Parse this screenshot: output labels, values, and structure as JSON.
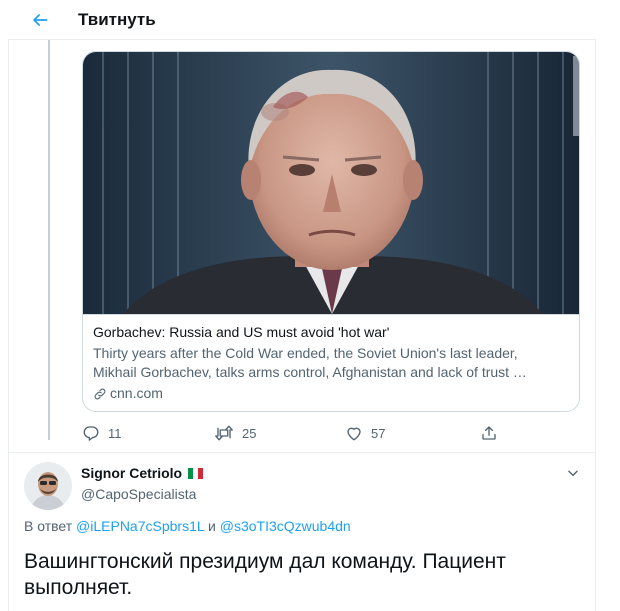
{
  "header": {
    "title": "Твитнуть"
  },
  "card": {
    "title": "Gorbachev: Russia and US must avoid 'hot war'",
    "description_line1": "Thirty years after the Cold War ended, the Soviet Union's last leader,",
    "description_line2": "Mikhail Gorbachev, talks arms control, Afghanistan and lack of trust …",
    "domain": "cnn.com"
  },
  "actions": {
    "replies": "11",
    "retweets": "25",
    "likes": "57"
  },
  "reply": {
    "user_name": "Signor Cetriolo",
    "user_handle": "@CapoSpecialista",
    "reply_prefix": "В ответ",
    "mention1": "@iLEPNa7cSpbrs1L",
    "conjunction": "и",
    "mention2": "@s3oTI3cQzwub4dn",
    "text": "Вашингтонский президиум дал команду. Пациент выполняет."
  },
  "colors": {
    "accent": "#1da1f2",
    "secondary_text": "#536471",
    "border": "#cfd9de"
  },
  "icons": [
    "back-arrow-icon",
    "link-icon",
    "reply-icon",
    "retweet-icon",
    "like-icon",
    "share-icon",
    "chevron-down-icon",
    "italy-flag-icon"
  ]
}
